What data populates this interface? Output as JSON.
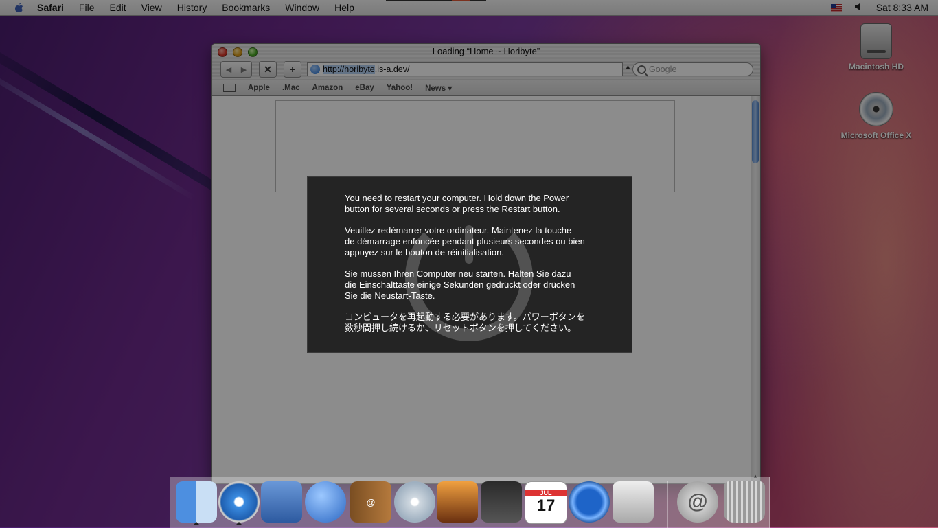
{
  "menubar": {
    "app": "Safari",
    "items": [
      "File",
      "Edit",
      "View",
      "History",
      "Bookmarks",
      "Window",
      "Help"
    ],
    "clock": "Sat 8:33 AM"
  },
  "desktop": {
    "icons": [
      {
        "label": "Macintosh HD"
      },
      {
        "label": "Microsoft Office X"
      }
    ]
  },
  "window": {
    "title": "Loading “Home ~ Horibyte”",
    "url_selected": "http://horibyte",
    "url_rest": ".is-a.dev/",
    "search_placeholder": "Google",
    "bookmarks": [
      "Apple",
      ".Mac",
      "Amazon",
      "eBay",
      "Yahoo!",
      "News ▾"
    ]
  },
  "panic": {
    "en": "You need to restart your computer. Hold down the Power\nbutton for several seconds or press the Restart button.",
    "fr": "Veuillez redémarrer votre ordinateur. Maintenez la touche\nde démarrage enfoncée pendant plusieurs secondes ou bien\nappuyez sur le bouton de réinitialisation.",
    "de": "Sie müssen Ihren Computer neu starten. Halten Sie dazu\ndie Einschalttaste einige Sekunden gedrückt oder drücken\nSie die Neustart-Taste.",
    "ja": "コンピュータを再起動する必要があります。パワーボタンを\n数秒間押し続けるか、リセットボタンを押してください。"
  },
  "dock": {
    "calendar_month": "JUL",
    "calendar_day": "17",
    "icons": [
      "finder-icon",
      "safari-icon",
      "mail-icon",
      "ichat-icon",
      "address-book-icon",
      "itunes-icon",
      "iphoto-icon",
      "imovie-icon",
      "ical-icon",
      "quicktime-icon",
      "system-preferences-icon",
      "internet-connect-icon",
      "trash-icon"
    ]
  }
}
